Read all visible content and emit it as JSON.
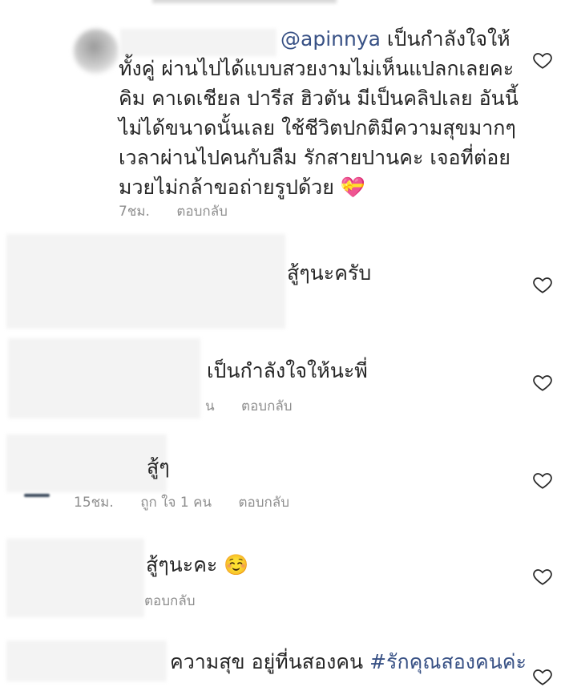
{
  "comments": [
    {
      "mention": "@apinnya",
      "lines": [
        "เป็นกำลังใจให้",
        "ทั้งคู่ ผ่านไปได้แบบสวยงามไม่เห็นแปลกเลยคะ",
        "คิม คาเดเชียล ปารีส ฮิวตัน มีเป็นคลิปเลย อันนี้",
        "ไม่ได้ขนาดนั้นเลย ใช้ชีวิตปกติมีความสุขมากๆ",
        "เวลาผ่านไปคนกับลืม รักสายปานคะ เจอที่ต่อย",
        "มวยไม่กล้าขอถ่ายรูปด้วย"
      ],
      "emoji": "💝",
      "time": "7ชม.",
      "reply": "ตอบกลับ"
    },
    {
      "text": "สู้ๆนะครับ"
    },
    {
      "text": "เป็นกำลังใจให้นะพี่",
      "time_partial": "น",
      "reply": "ตอบกลับ"
    },
    {
      "text": "สู้ๆ",
      "time": "15ชม.",
      "likes": "ถูก ใจ 1 คน",
      "reply": "ตอบกลับ"
    },
    {
      "text": "สู้ๆนะคะ",
      "emoji": "☺️",
      "reply": "ตอบกลับ"
    },
    {
      "text": "ความสุข อยู่ที่นสองคน",
      "hashtag": "#รักคุณสองคนค่ะ"
    }
  ],
  "icons": {
    "like": "heart-outline-icon"
  }
}
